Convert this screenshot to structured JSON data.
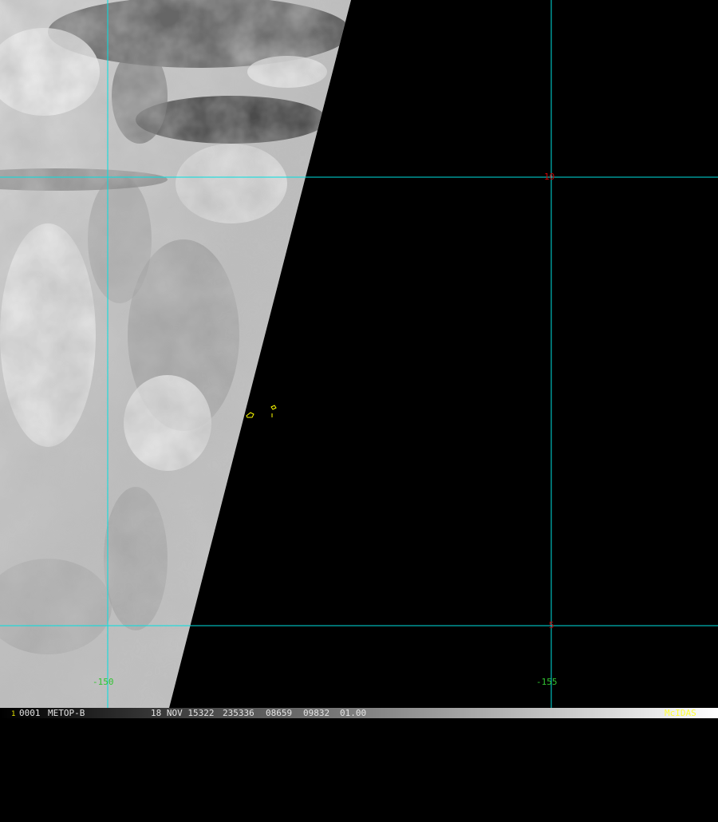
{
  "map": {
    "latitude_lines": [
      "10",
      "5"
    ],
    "longitude_lines": [
      "-150",
      "-155"
    ],
    "grid_color": "#00e0e0",
    "coastline_color": "#ffff00",
    "lat_label_color": "#d40000",
    "lon_label_color": "#31c431"
  },
  "status_bar": {
    "frame_number": "1",
    "frame_id": "0001",
    "satellite": "METOP-B",
    "date": "18 NOV 15322",
    "time": "235336",
    "line": "08659",
    "element": "09832",
    "resolution": "01.00",
    "software": "McIDAS"
  }
}
